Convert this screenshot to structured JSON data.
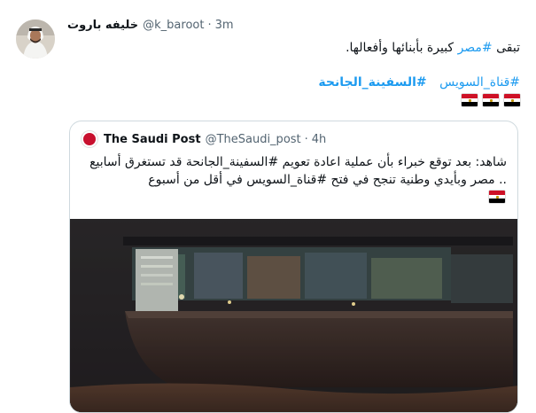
{
  "tweet": {
    "author_name": "خليفه باروت",
    "author_handle": "@k_baroot",
    "separator": "·",
    "time": "3m",
    "text_before": "تبقى ",
    "text_hashtag": "#مصر",
    "text_after": " كبيرة بأبنائها وأفعالها.",
    "hashtags": [
      "#قناة_السويس",
      "#السفينة_الجانحة"
    ],
    "flag_count": 3
  },
  "quote": {
    "author_name": "The Saudi Post",
    "author_handle": "@TheSaudi_post",
    "separator": "·",
    "time": "4h",
    "text": "شاهد: بعد توقع خبراء بأن عملية اعادة تعويم #السفينة_الجانحة قد تستغرق أسابيع .. مصر وبأيدي وطنية تنجح في فتح #قناة_السويس في أقل من أسبوع"
  },
  "colors": {
    "link": "#1d9bf0",
    "secondary_text": "#536471",
    "border": "#cfd9de",
    "flag_red": "#ce1126",
    "flag_white": "#ffffff",
    "flag_black": "#000000"
  },
  "icons": [
    "user-avatar",
    "saudi-post-logo",
    "egypt-flag-icon"
  ]
}
